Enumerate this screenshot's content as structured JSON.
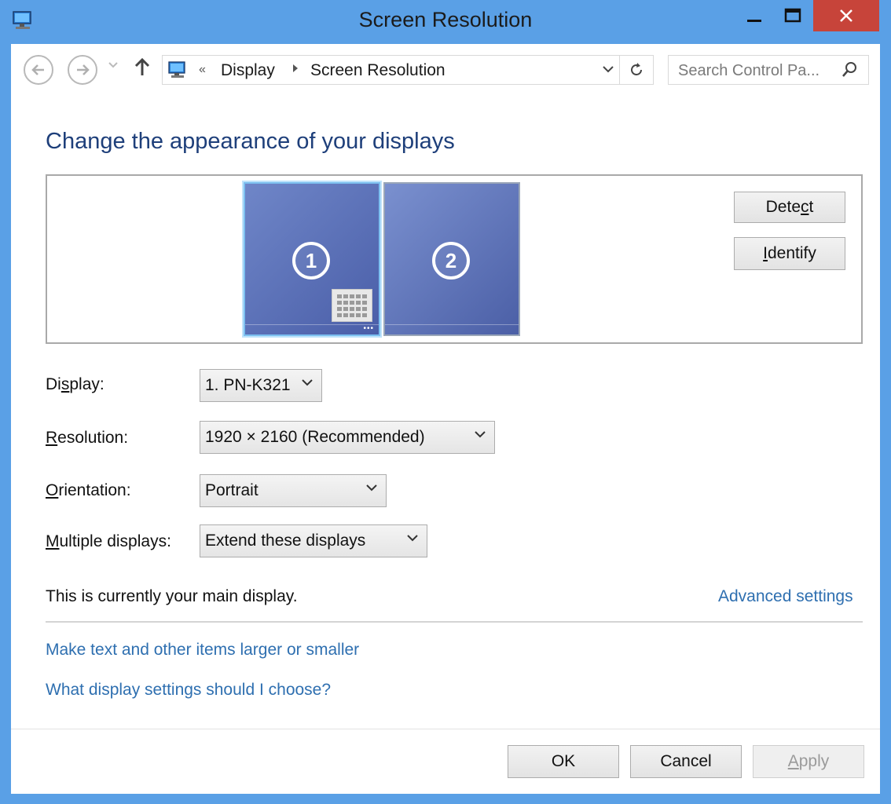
{
  "window": {
    "title": "Screen Resolution",
    "controls": {
      "minimize": "—",
      "maximize": "☐",
      "close": "✕"
    }
  },
  "nav": {
    "address": {
      "prefix": "«",
      "crumbs": [
        "Display",
        "Screen Resolution"
      ]
    },
    "search_placeholder": "Search Control Pa...",
    "icons": [
      "back-arrow-icon",
      "forward-arrow-icon",
      "recent-pages-icon",
      "up-arrow-icon",
      "control-panel-icon",
      "dropdown-icon",
      "refresh-icon",
      "search-icon"
    ]
  },
  "main": {
    "heading": "Change the appearance of your displays",
    "monitors": [
      {
        "number": "1",
        "selected": true
      },
      {
        "number": "2",
        "selected": false
      }
    ],
    "detect_button": {
      "before": "Dete",
      "accel": "c",
      "after": "t"
    },
    "identify_button": {
      "before": "",
      "accel": "I",
      "after": "dentify"
    },
    "fields": {
      "display": {
        "before": "Di",
        "accel": "s",
        "after": "play:",
        "value": "1. PN-K321"
      },
      "resolution": {
        "before": "",
        "accel": "R",
        "after": "esolution:",
        "value": "1920 × 2160 (Recommended)"
      },
      "orientation": {
        "before": "",
        "accel": "O",
        "after": "rientation:",
        "value": "Portrait"
      },
      "multiple": {
        "before": "",
        "accel": "M",
        "after": "ultiple displays:",
        "value": "Extend these displays"
      }
    },
    "status": "This is currently your main display.",
    "advanced_link": "Advanced settings",
    "links": [
      "Make text and other items larger or smaller",
      "What display settings should I choose?"
    ]
  },
  "footer": {
    "ok": "OK",
    "cancel": "Cancel",
    "apply": {
      "before": "",
      "accel": "A",
      "after": "pply",
      "enabled": false
    }
  },
  "colors": {
    "titlebar": "#5aa0e6",
    "close": "#c7443a",
    "heading": "#1e3f7a",
    "link": "#2e6fb0"
  }
}
